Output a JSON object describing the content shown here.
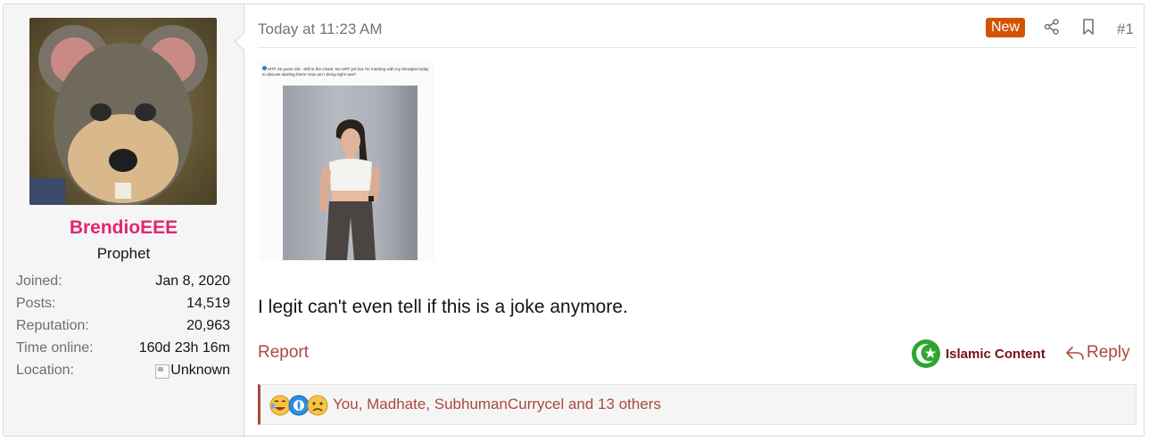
{
  "author": {
    "username": "BrendioEEE",
    "username_color": "#e02871",
    "user_title": "Prophet",
    "stats": [
      {
        "label": "Joined:",
        "value": "Jan 8, 2020"
      },
      {
        "label": "Posts:",
        "value": "14,519"
      },
      {
        "label": "Reputation:",
        "value": "20,963"
      },
      {
        "label": "Time online:",
        "value": "160d 23h 16m"
      },
      {
        "label": "Location:",
        "value": "Unknown"
      }
    ]
  },
  "post": {
    "timestamp": "Today at 11:23 AM",
    "new_badge": "New",
    "share_icon": "share-icon",
    "bookmark_icon": "bookmark-icon",
    "post_number": "#1",
    "attachment": {
      "header_text": "MTF 25 years old - Still in the closet. No HRT yet but I'm meeting with my therapist today to discuss starting them! How am I doing right now?"
    },
    "message": "I legit can't even tell if this is a joke anymore.",
    "report_label": "Report",
    "badge_label": "Islamic Content",
    "reply_label": "Reply",
    "reactions": {
      "icons": [
        "laughing-emoji-icon",
        "cry-emoji-icon",
        "sad-emoji-icon"
      ],
      "users_text": "You, Madhate, SubhumanCurrycel and 13 others"
    }
  },
  "colors": {
    "accent": "#a94a3c",
    "new_badge_bg": "#d35400",
    "sidebar_bg": "#f5f5f5"
  }
}
